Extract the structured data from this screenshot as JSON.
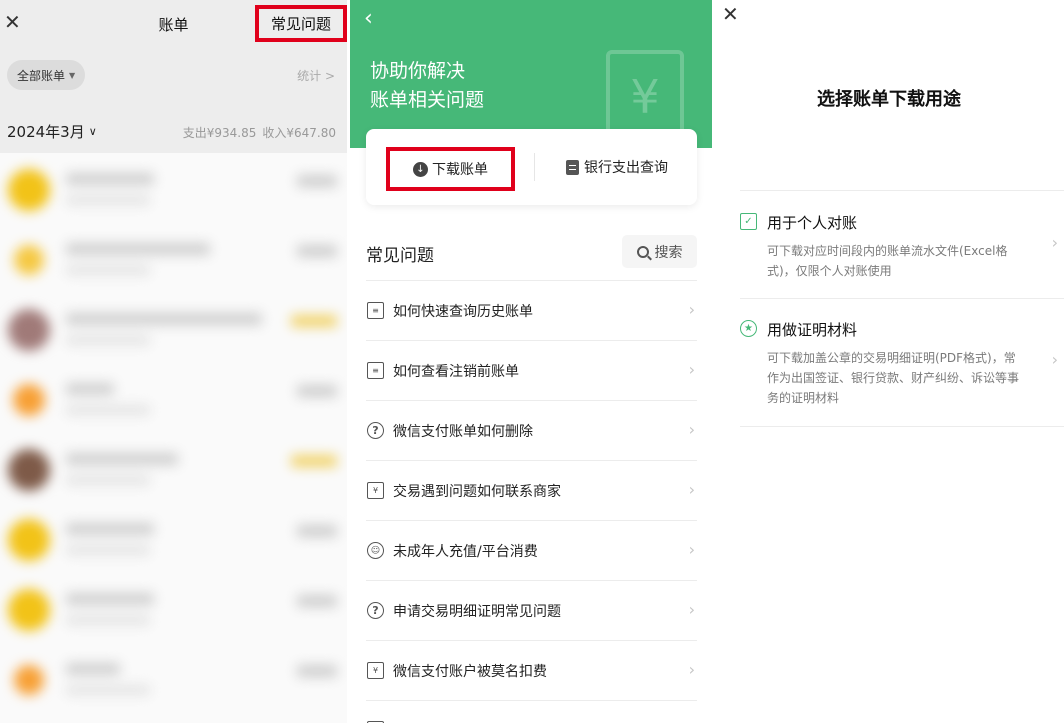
{
  "bill_list": {
    "close_icon": "close-icon",
    "title": "账单",
    "faq_link": "常见问题",
    "filter_label": "全部账单",
    "stats_link": "统计 >",
    "month": "2024年3月",
    "expense": "支出¥934.85",
    "income": "收入¥647.80",
    "transactions": [
      {
        "avatar_color": "#f2c318",
        "name": "▇▇▇▇▇▇▇▇",
        "sub": "▇▇▇▇▇",
        "amount_color": "#cdcdcd"
      },
      {
        "avatar_color": "#f5c842",
        "name": "▇▇▇▇▇▇▇▇▇▇▇▇",
        "sub": "▇▇▇▇▇",
        "amount_color": "#cdcdcd"
      },
      {
        "avatar_color": "#a07a78",
        "name": "▇▇▇▇▇▇▇▇▇▇▇▇▇▇▇",
        "sub": "▇▇▇▇▇",
        "amount_color": "#f1d36b"
      },
      {
        "avatar_color": "#f7a035",
        "name": "▇▇▇▇▇",
        "sub": "▇▇▇▇▇",
        "amount_color": "#cdcdcd"
      },
      {
        "avatar_color": "#7e5a48",
        "name": "▇▇▇▇▇▇▇▇▇▇",
        "sub": "▇▇▇▇▇",
        "amount_color": "#f1d36b"
      },
      {
        "avatar_color": "#f2c318",
        "name": "▇▇▇▇▇▇▇▇",
        "sub": "▇▇▇▇▇",
        "amount_color": "#cdcdcd"
      },
      {
        "avatar_color": "#f2c318",
        "name": "▇▇▇▇▇▇▇▇",
        "sub": "▇▇▇▇▇",
        "amount_color": "#cdcdcd"
      },
      {
        "avatar_color": "#f7a035",
        "name": "▇▇▇▇▇",
        "sub": "▇▇▇▇▇",
        "amount_color": "#cdcdcd"
      }
    ]
  },
  "help_center": {
    "back_icon": "chevron-left-icon",
    "hero_title_line1": "协助你解决",
    "hero_title_line2": "账单相关问题",
    "download_label": "下载账单",
    "bank_query_label": "银行支出查询",
    "faq_title": "常见问题",
    "search_label": "搜索",
    "questions": [
      {
        "icon": "document-icon",
        "text": "如何快速查询历史账单"
      },
      {
        "icon": "document-icon",
        "text": "如何查看注销前账单"
      },
      {
        "icon": "help-circle-icon",
        "text": "微信支付账单如何删除"
      },
      {
        "icon": "receipt-icon",
        "text": "交易遇到问题如何联系商家"
      },
      {
        "icon": "child-icon",
        "text": "未成年人充值/平台消费"
      },
      {
        "icon": "help-circle-icon",
        "text": "申请交易明细证明常见问题"
      },
      {
        "icon": "receipt-icon",
        "text": "微信支付账户被莫名扣费"
      }
    ]
  },
  "download_purpose": {
    "close_icon": "close-icon",
    "title": "选择账单下载用途",
    "options": [
      {
        "title": "用于个人对账",
        "desc": "可下载对应时间段内的账单流水文件(Excel格式)，仅限个人对账使用"
      },
      {
        "title": "用做证明材料",
        "desc": "可下载加盖公章的交易明细证明(PDF格式)，常作为出国签证、银行贷款、财产纠纷、诉讼等事务的证明材料"
      }
    ]
  },
  "colors": {
    "accent_green": "#46b878",
    "highlight_red": "#e0001b"
  }
}
